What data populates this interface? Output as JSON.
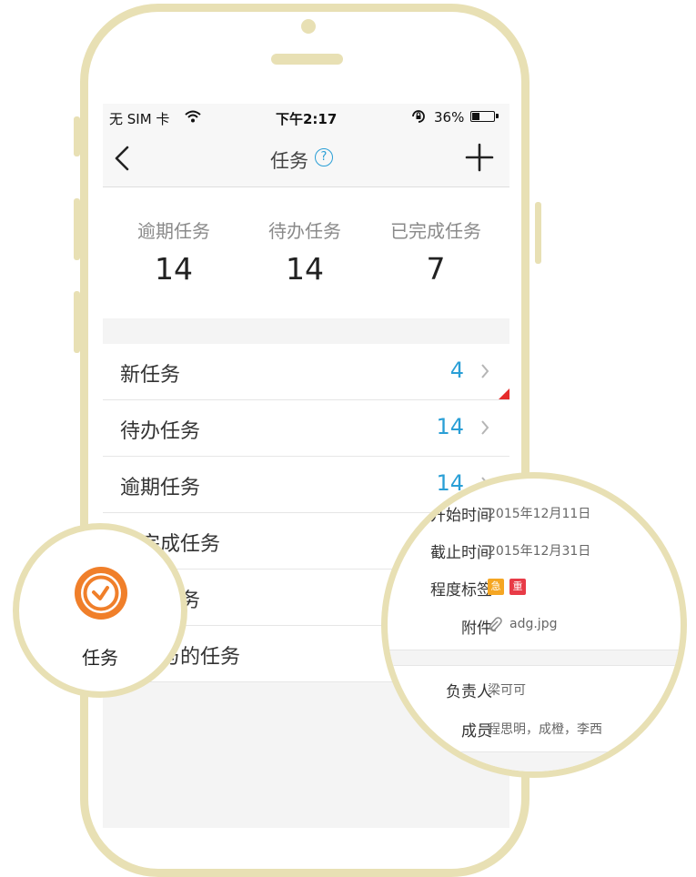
{
  "status_bar": {
    "carrier": "无 SIM 卡",
    "time": "下午2:17",
    "battery": "36%",
    "battery_level": 0.36
  },
  "nav": {
    "title": "任务",
    "help": "?"
  },
  "stats": [
    {
      "label": "逾期任务",
      "value": "14"
    },
    {
      "label": "待办任务",
      "value": "14"
    },
    {
      "label": "已完成任务",
      "value": "7"
    }
  ],
  "list": [
    {
      "label": "新任务",
      "count": "4"
    },
    {
      "label": "待办任务",
      "count": "14"
    },
    {
      "label": "逾期任务",
      "count": "14"
    },
    {
      "label": "已完成任务",
      "count": ""
    },
    {
      "label": "我的任务",
      "count": ""
    },
    {
      "label": "我参与的任务",
      "count": ""
    }
  ],
  "zoom_left": {
    "caption": "任务"
  },
  "zoom_right": {
    "start_label": "开始时间",
    "start_value": "2015年12月11日",
    "end_label": "截止时间",
    "end_value": "2015年12月31日",
    "tags_label": "程度标签",
    "tags": [
      {
        "text": "急",
        "color": "#f5a623"
      },
      {
        "text": "重",
        "color": "#e83b47"
      }
    ],
    "attachment_label": "附件",
    "attachment_value": "adg.jpg",
    "owner_label": "负责人",
    "owner_value": "梁可可",
    "members_label": "成员",
    "members_value": "程思明，成橙，李西"
  },
  "colors": {
    "frame": "#e8e0b4",
    "accent_blue": "#2a9fd6",
    "alert_red": "#e52b2b",
    "clock_orange": "#f07f2a"
  }
}
